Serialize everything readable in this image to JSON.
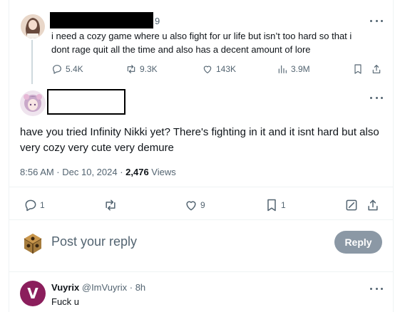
{
  "parent_tweet": {
    "time_suffix": "9",
    "text_line1": "i need a cozy game where u also fight for ur life but isn’t too hard so that i",
    "text_line2": "dont rage quit all the time and also has a decent amount of lore",
    "stats": {
      "replies": "5.4K",
      "reposts": "9.3K",
      "likes": "143K",
      "views": "3.9M"
    }
  },
  "main_tweet": {
    "text": "have you tried Infinity Nikki yet? There's fighting in it and it isnt hard but also very cozy very cute very demure",
    "timestamp": "8:56 AM · Dec 10, 2024 · ",
    "views_count": "2,476",
    "views_label": " Views",
    "stats": {
      "replies": "1",
      "likes": "9",
      "bookmarks": "1"
    }
  },
  "composer": {
    "placeholder": "Post your reply",
    "button_label": "Reply"
  },
  "reply_tweet": {
    "name": "Vuyrix",
    "handle_time": " @ImVuyrix · 8h",
    "text": "Fuck u",
    "avatar_letter": "V"
  },
  "colors": {
    "text": "#0f1419",
    "muted": "#536471",
    "reply_button": "#8b98a5",
    "avatar_v": "#8b1e5c"
  }
}
